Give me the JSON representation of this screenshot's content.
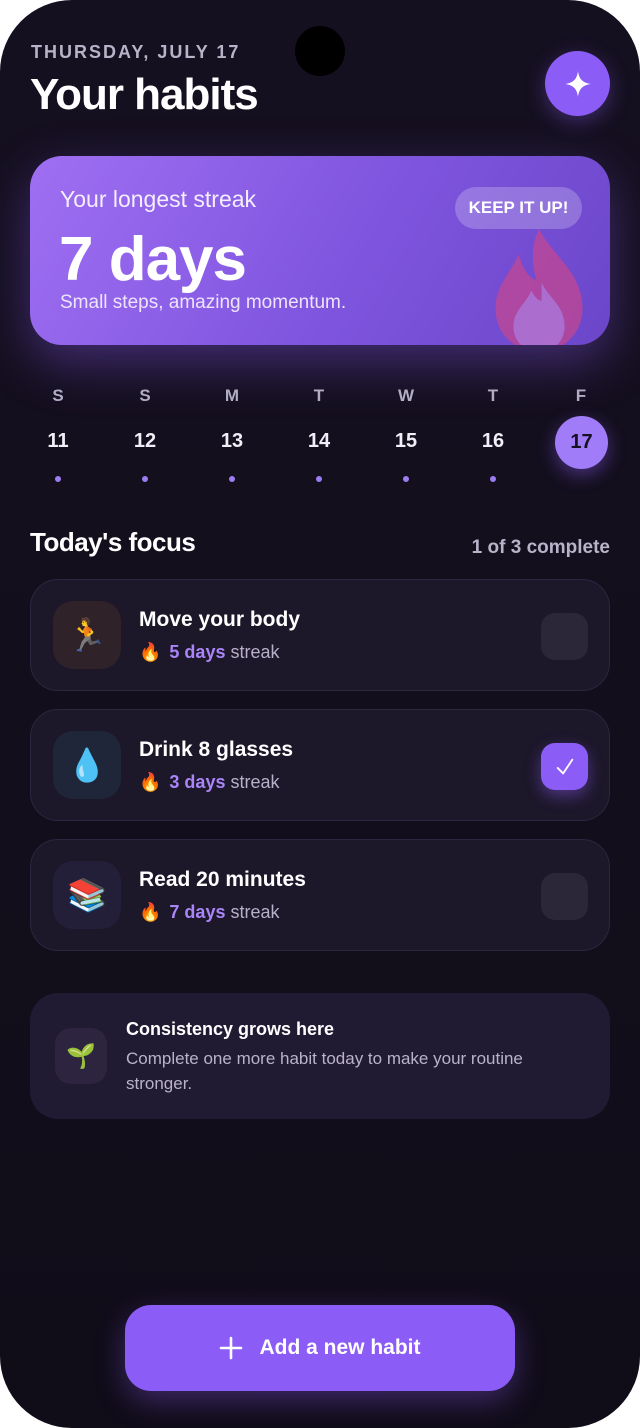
{
  "header": {
    "date": "THURSDAY, JULY 17",
    "title": "Your habits",
    "action_icon": "sparkle-icon"
  },
  "streak_card": {
    "label": "Your longest streak",
    "value": "7 days",
    "subtitle": "Small steps, amazing momentum.",
    "badge": "KEEP IT UP!",
    "decor_icon": "flame-icon"
  },
  "week": {
    "days": [
      {
        "weekday": "S",
        "date": "11",
        "dot": true
      },
      {
        "weekday": "S",
        "date": "12",
        "dot": true
      },
      {
        "weekday": "M",
        "date": "13",
        "dot": true
      },
      {
        "weekday": "T",
        "date": "14",
        "dot": true
      },
      {
        "weekday": "W",
        "date": "15",
        "dot": true
      },
      {
        "weekday": "T",
        "date": "16",
        "dot": true
      },
      {
        "weekday": "F",
        "date": "17",
        "dot": false,
        "selected": true
      }
    ]
  },
  "focus": {
    "title": "Today's focus",
    "progress": "1 of 3 complete",
    "habits": [
      {
        "name": "Move your body",
        "emoji": "🏃",
        "icon": "runner-icon",
        "icon_bg": "#2f2229",
        "streak_count": "5 days",
        "streak_suffix": "streak",
        "done": false
      },
      {
        "name": "Drink 8 glasses",
        "emoji": "💧",
        "icon": "water-drop-icon",
        "icon_bg": "#1f2639",
        "streak_count": "3 days",
        "streak_suffix": "streak",
        "done": true
      },
      {
        "name": "Read 20 minutes",
        "emoji": "📚",
        "icon": "books-icon",
        "icon_bg": "#241f38",
        "streak_count": "7 days",
        "streak_suffix": "streak",
        "done": false
      }
    ]
  },
  "tip": {
    "emoji": "🌱",
    "icon": "seedling-icon",
    "title": "Consistency grows here",
    "text": "Complete one more habit today to make your routine stronger."
  },
  "add_button": {
    "label": "Add a new habit",
    "icon": "plus-icon"
  },
  "colors": {
    "accent": "#8b5cf6",
    "background": "#130f1c",
    "card": "#1c1729"
  }
}
